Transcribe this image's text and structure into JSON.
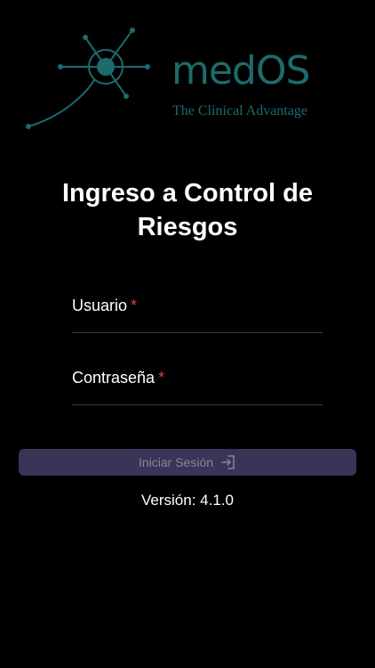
{
  "brand": {
    "name": "medOS",
    "tagline": "The Clinical Advantage",
    "color": "#1d6b6c",
    "logo_icon": "network-node-logo-icon"
  },
  "login": {
    "title": "Ingreso a Control de Riesgos",
    "username_label": "Usuario",
    "password_label": "Contraseña",
    "required_mark": "*",
    "username_value": "",
    "password_value": "",
    "submit_label": "Iniciar Sesión",
    "submit_icon": "sign-in-icon"
  },
  "footer": {
    "version": "Versión: 4.1.0"
  },
  "colors": {
    "background": "#000000",
    "button": "#3a3458",
    "button_text": "#8a8694",
    "required": "#e03a3a",
    "divider": "#3a3a3c"
  }
}
